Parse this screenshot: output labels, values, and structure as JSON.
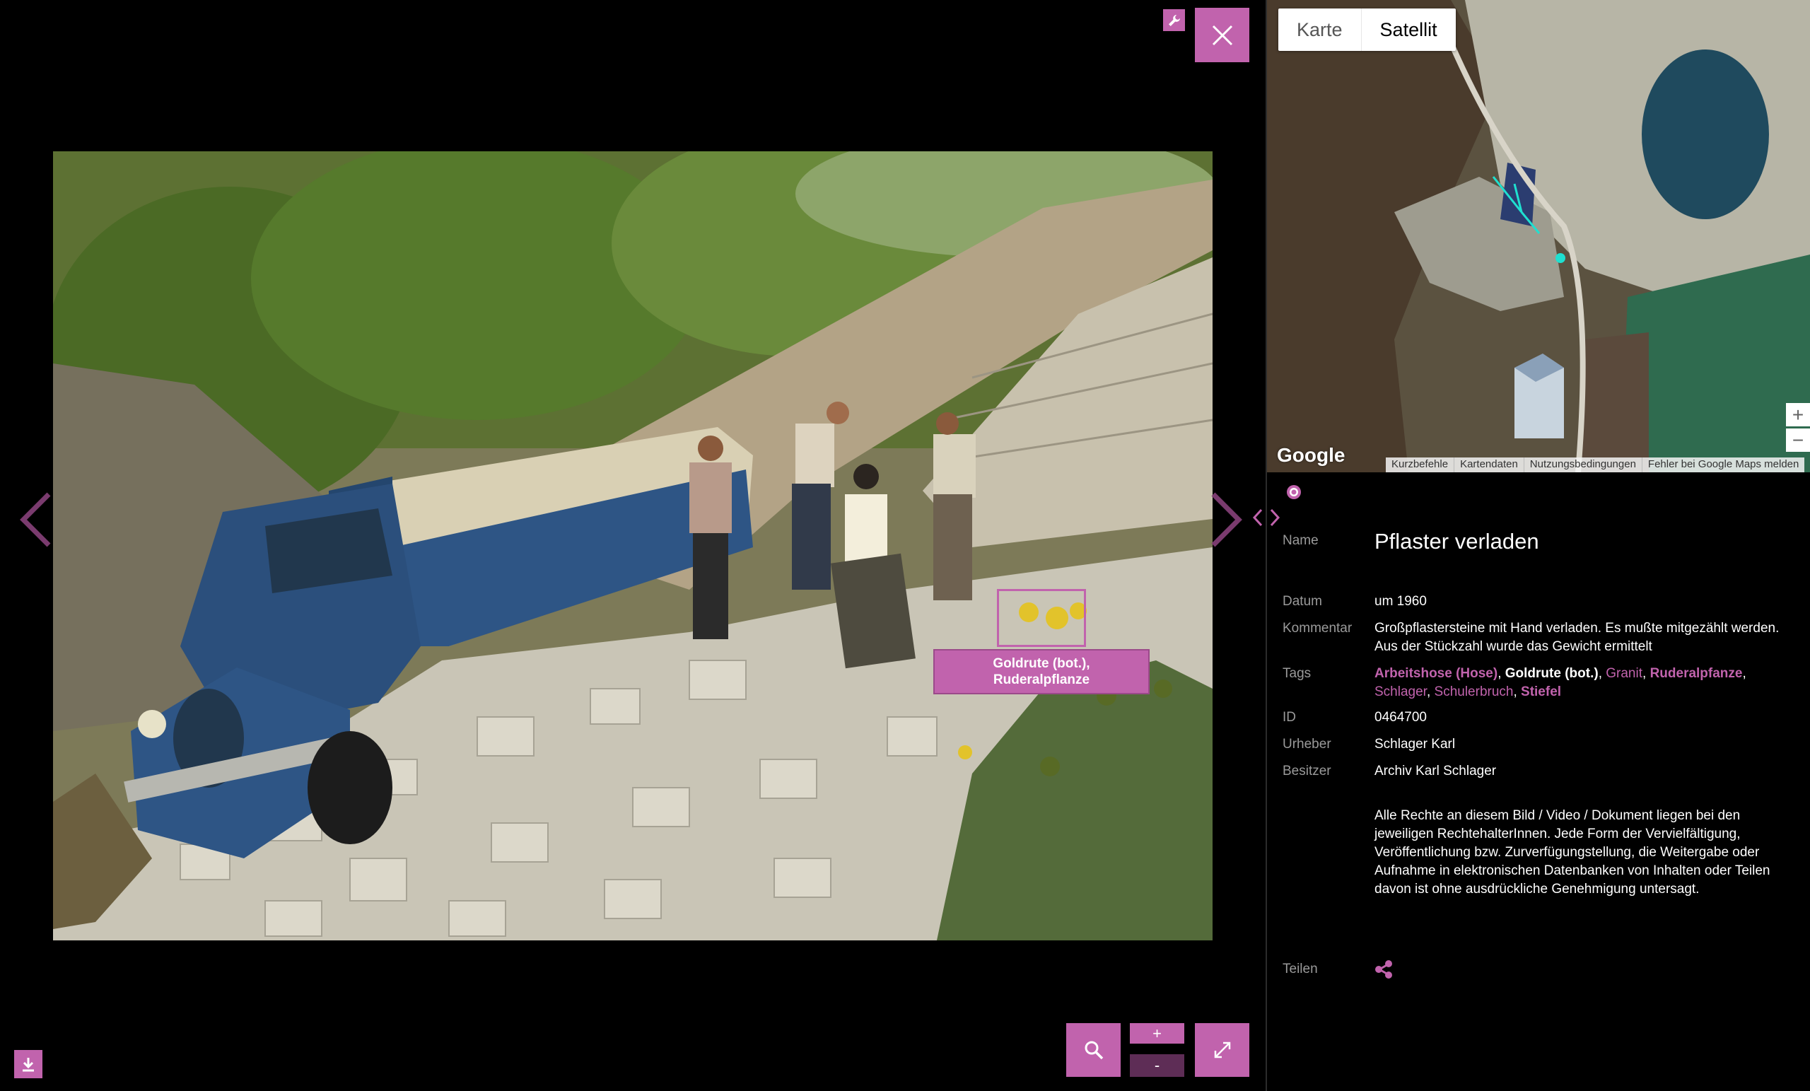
{
  "tooltip": {
    "text": "Goldrute (bot.),\nRuderalpflanze"
  },
  "viewer": {
    "zoom_in_label": "+",
    "zoom_out_label": "-"
  },
  "map": {
    "type_karte": "Karte",
    "type_satellit": "Satellit",
    "logo": "Google",
    "attribution": [
      "Kurzbefehle",
      "Kartendaten",
      "Nutzungsbedingungen",
      "Fehler bei Google Maps melden"
    ],
    "zoom_in": "+",
    "zoom_out": "−"
  },
  "info": {
    "name_label": "Name",
    "name": "Pflaster verladen",
    "date_label": "Datum",
    "date": "um 1960",
    "comment_label": "Kommentar",
    "comment": "Großpflastersteine mit Hand verladen. Es mußte mitgezählt werden. Aus der Stückzahl wurde das Gewicht ermittelt",
    "tags_label": "Tags",
    "tags": [
      {
        "text": "Arbeitshose (Hose)",
        "style": "pink-bold"
      },
      {
        "text": "Goldrute (bot.)",
        "style": "white-bold"
      },
      {
        "text": "Granit",
        "style": "pink"
      },
      {
        "text": "Ruderalpfanze",
        "style": "pink-bold"
      },
      {
        "text": "Schlager",
        "style": "pink"
      },
      {
        "text": "Schulerbruch",
        "style": "pink"
      },
      {
        "text": "Stiefel",
        "style": "pink-bold"
      }
    ],
    "id_label": "ID",
    "id": "0464700",
    "author_label": "Urheber",
    "author": "Schlager Karl",
    "owner_label": "Besitzer",
    "owner": "Archiv Karl Schlager",
    "rights": "Alle Rechte an diesem Bild / Video / Dokument liegen bei den jeweiligen RechtehalterInnen. Jede Form der Vervielfältigung, Veröffentlichung bzw. Zurverfügungstellung, die Weitergabe oder Aufnahme in elektronischen Datenbanken von Inhalten oder Teilen davon ist ohne ausdrückliche Genehmigung untersagt.",
    "share_label": "Teilen"
  },
  "colors": {
    "accent": "#c163ad",
    "accent_dark": "#5e2d56"
  }
}
